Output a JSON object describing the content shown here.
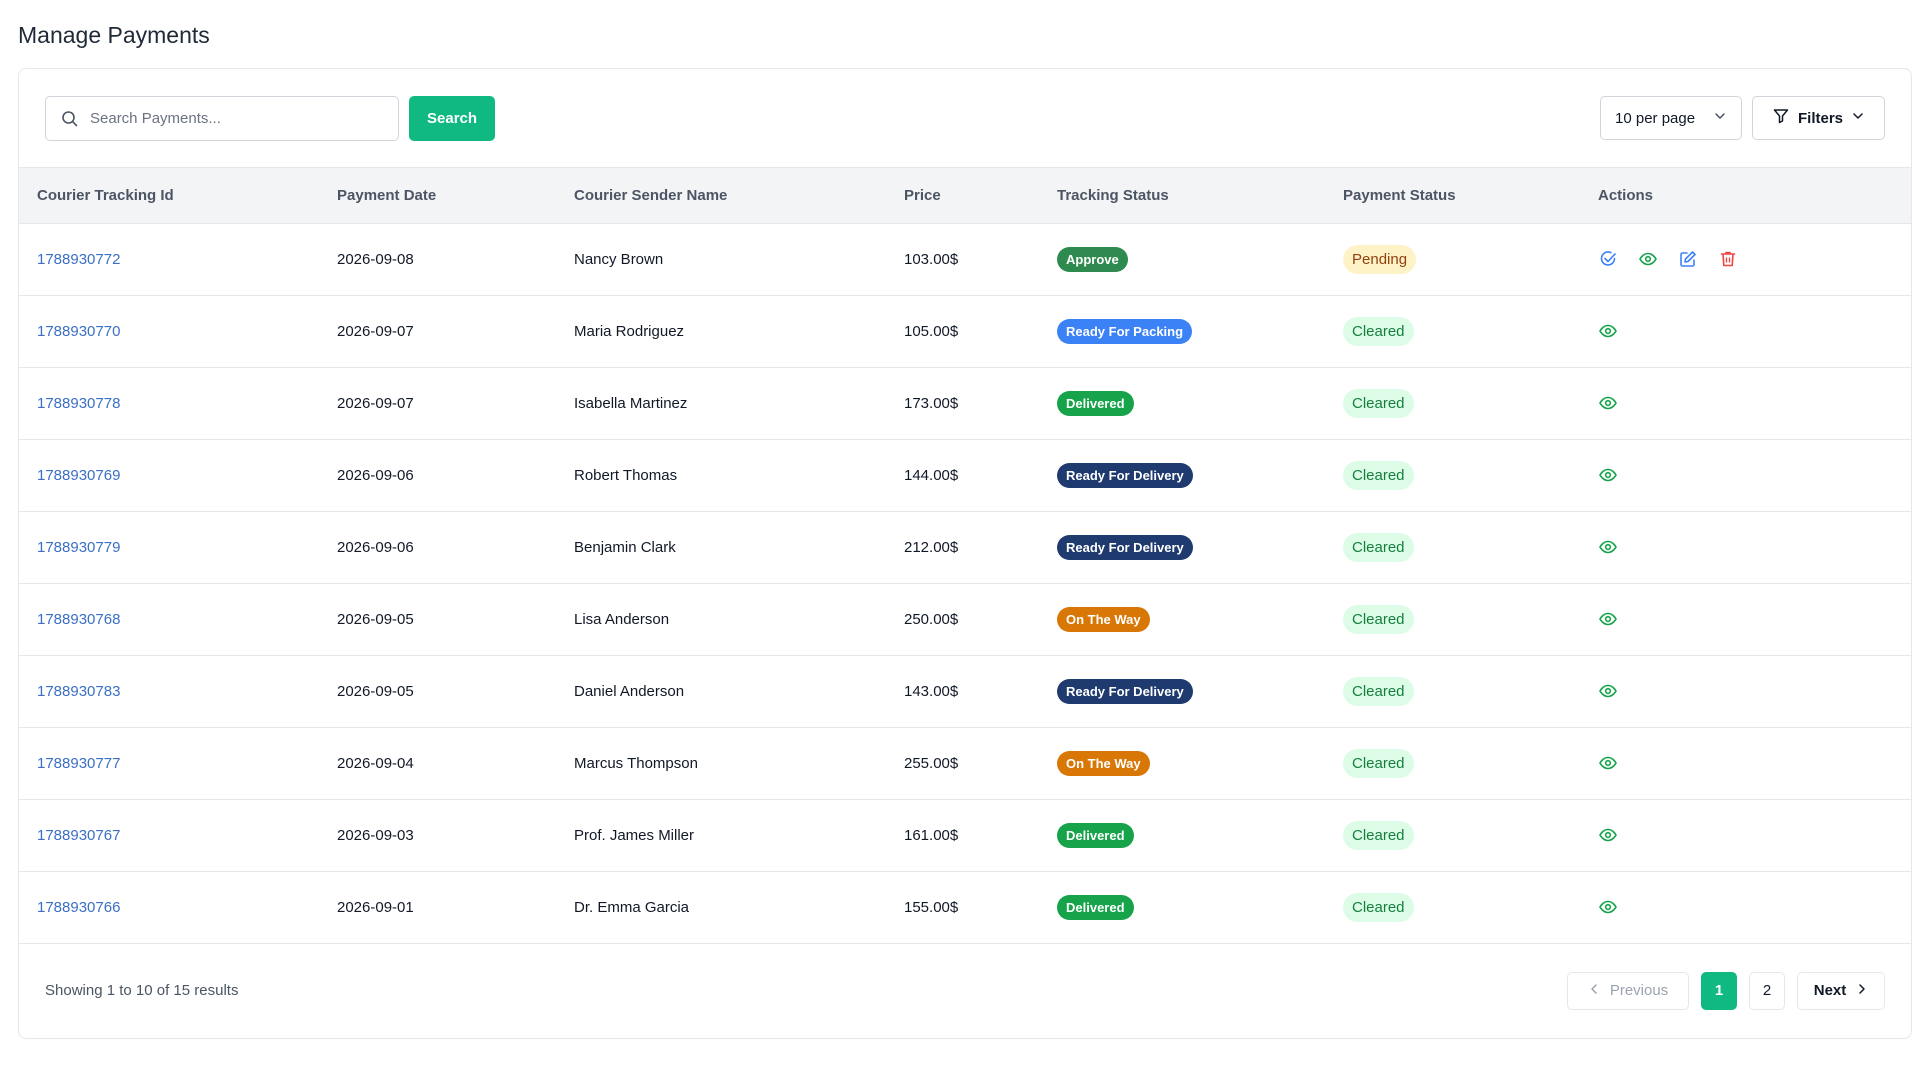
{
  "page": {
    "title": "Manage Payments"
  },
  "toolbar": {
    "search_placeholder": "Search Payments...",
    "search_label": "Search",
    "per_page_label": "10 per page",
    "filters_label": "Filters"
  },
  "table": {
    "headers": [
      "Courier Tracking Id",
      "Payment Date",
      "Courier Sender Name",
      "Price",
      "Tracking Status",
      "Payment Status",
      "Actions"
    ],
    "rows": [
      {
        "tracking_id": "1788930772",
        "date": "2026-09-08",
        "sender": "Nancy Brown",
        "price": "103.00$",
        "tracking_status": "Approve",
        "payment_status": "Pending",
        "actions": [
          "approve",
          "view",
          "edit",
          "delete"
        ]
      },
      {
        "tracking_id": "1788930770",
        "date": "2026-09-07",
        "sender": "Maria Rodriguez",
        "price": "105.00$",
        "tracking_status": "Ready For Packing",
        "payment_status": "Cleared",
        "actions": [
          "view"
        ]
      },
      {
        "tracking_id": "1788930778",
        "date": "2026-09-07",
        "sender": "Isabella Martinez",
        "price": "173.00$",
        "tracking_status": "Delivered",
        "payment_status": "Cleared",
        "actions": [
          "view"
        ]
      },
      {
        "tracking_id": "1788930769",
        "date": "2026-09-06",
        "sender": "Robert Thomas",
        "price": "144.00$",
        "tracking_status": "Ready For Delivery",
        "payment_status": "Cleared",
        "actions": [
          "view"
        ]
      },
      {
        "tracking_id": "1788930779",
        "date": "2026-09-06",
        "sender": "Benjamin Clark",
        "price": "212.00$",
        "tracking_status": "Ready For Delivery",
        "payment_status": "Cleared",
        "actions": [
          "view"
        ]
      },
      {
        "tracking_id": "1788930768",
        "date": "2026-09-05",
        "sender": "Lisa Anderson",
        "price": "250.00$",
        "tracking_status": "On The Way",
        "payment_status": "Cleared",
        "actions": [
          "view"
        ]
      },
      {
        "tracking_id": "1788930783",
        "date": "2026-09-05",
        "sender": "Daniel Anderson",
        "price": "143.00$",
        "tracking_status": "Ready For Delivery",
        "payment_status": "Cleared",
        "actions": [
          "view"
        ]
      },
      {
        "tracking_id": "1788930777",
        "date": "2026-09-04",
        "sender": "Marcus Thompson",
        "price": "255.00$",
        "tracking_status": "On The Way",
        "payment_status": "Cleared",
        "actions": [
          "view"
        ]
      },
      {
        "tracking_id": "1788930767",
        "date": "2026-09-03",
        "sender": "Prof. James Miller",
        "price": "161.00$",
        "tracking_status": "Delivered",
        "payment_status": "Cleared",
        "actions": [
          "view"
        ]
      },
      {
        "tracking_id": "1788930766",
        "date": "2026-09-01",
        "sender": "Dr. Emma Garcia",
        "price": "155.00$",
        "tracking_status": "Delivered",
        "payment_status": "Cleared",
        "actions": [
          "view"
        ]
      }
    ]
  },
  "status_colors": {
    "Approve": "#2f8a4f",
    "Ready For Packing": "#3b82f6",
    "Delivered": "#16a34a",
    "Ready For Delivery": "#1e3a6e",
    "On The Way": "#d97706"
  },
  "payment_status_colors": {
    "Pending": {
      "bg": "#fef3c7",
      "fg": "#92400e"
    },
    "Cleared": {
      "bg": "#dcfce7",
      "fg": "#15803d"
    }
  },
  "action_icons": {
    "approve": {
      "icon": "check-circle-icon",
      "color": "#3b82f6"
    },
    "view": {
      "icon": "eye-icon",
      "color": "#16a34a"
    },
    "edit": {
      "icon": "edit-icon",
      "color": "#3b82f6"
    },
    "delete": {
      "icon": "trash-icon",
      "color": "#ef4444"
    }
  },
  "footer": {
    "results_text": "Showing 1 to 10 of 15 results",
    "previous_label": "Previous",
    "next_label": "Next",
    "pages": [
      "1",
      "2"
    ],
    "current_page": "1"
  },
  "colors": {
    "accent": "#10b981",
    "link": "#3b6fc4"
  }
}
